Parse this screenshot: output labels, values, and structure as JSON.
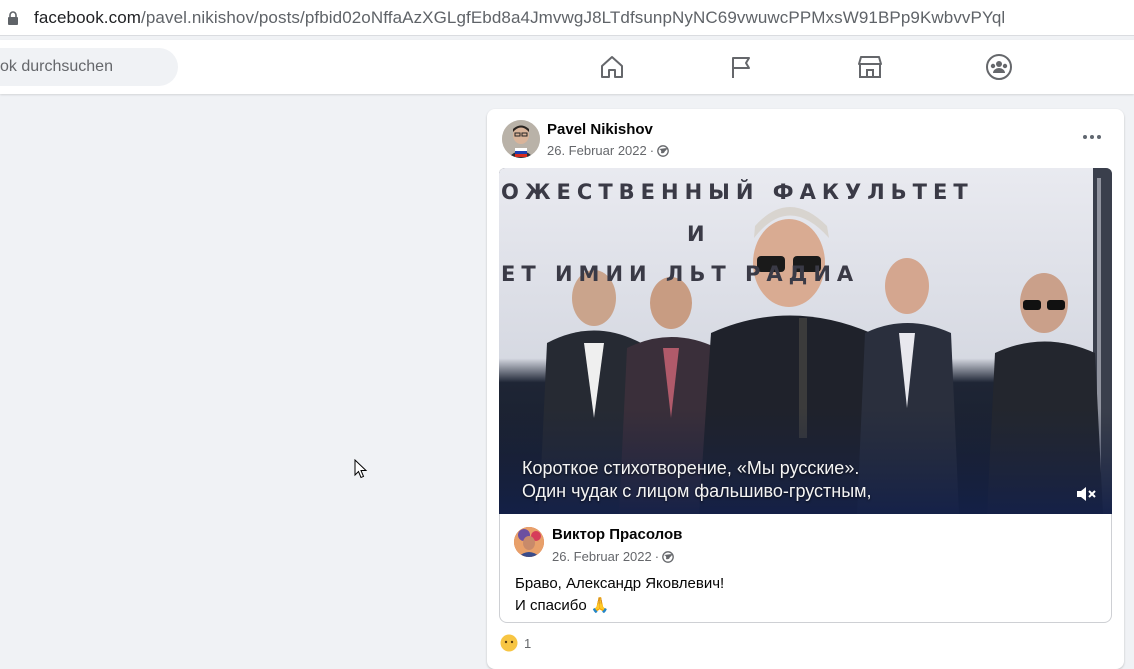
{
  "browser": {
    "url_host": "facebook.com",
    "url_path": "/pavel.nikishov/posts/pfbid02oNffaAzXGLgfEbd8a4JmvwgJ8LTdfsunpNyNC69vwuwcPPMxsW91BPp9KwbvvPYql"
  },
  "topnav": {
    "search_placeholder": "ok durchsuchen",
    "icons": [
      "home-icon",
      "flag-icon",
      "marketplace-icon",
      "groups-icon"
    ]
  },
  "post": {
    "author": "Pavel Nikishov",
    "date": "26. Februar 2022",
    "date_separator": "·",
    "video": {
      "banner_line1": "ОЖЕСТВЕННЫЙ ФАКУЛЬТЕТ",
      "banner_line2": "И",
      "banner_line3": "ЕТ ИМИИ    ЛЬТ РАДИА",
      "subtitle_line1": "Короткое стихотворение, «Мы русские».",
      "subtitle_line2": "Один чудак с лицом фальшиво-грустным,"
    },
    "shared": {
      "author": "Виктор Прасолов",
      "date": "26. Februar 2022",
      "date_separator": "·",
      "text_line1": "Браво, Александр Яковлевич!",
      "text_line2": "И спасибо 🙏"
    },
    "reaction_count": "1"
  },
  "colors": {
    "page_bg": "#f0f2f5",
    "card_bg": "#ffffff",
    "secondary_text": "#65676b"
  }
}
